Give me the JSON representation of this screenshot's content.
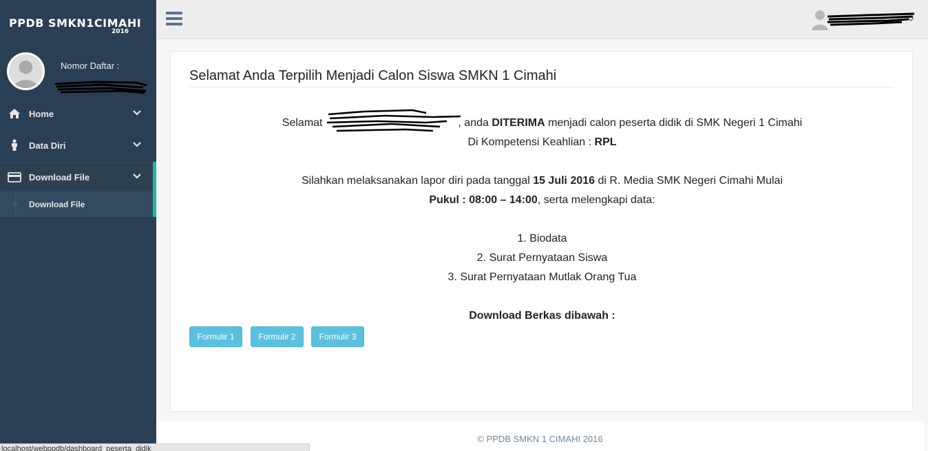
{
  "sidebar": {
    "brand": "PPDB  SMKN1CIMAHI",
    "brand_year": "2016",
    "profile_label": "Nomor Daftar :",
    "menu": [
      {
        "label": "Home",
        "icon": "home-icon"
      },
      {
        "label": "Data Diri",
        "icon": "user-icon"
      },
      {
        "label": "Download File",
        "icon": "credit-card-icon"
      }
    ],
    "submenu": [
      {
        "label": "Download File"
      }
    ]
  },
  "main": {
    "title": "Selamat Anda Terpilih Menjadi Calon Siswa SMKN 1 Cimahi",
    "line1_pre": "Selamat",
    "line1_mid": " , anda ",
    "line1_bold": "DITERIMA",
    "line1_post": " menjadi calon peserta didik di SMK Negeri 1 Cimahi",
    "line2_pre": "Di Kompetensi Keahlian : ",
    "line2_bold": "RPL",
    "line3_pre": "Silahkan melaksanakan lapor diri pada tanggal ",
    "line3_bold": "15 Juli 2016",
    "line3_post": " di R. Media SMK Negeri Cimahi Mulai",
    "line4_bold": "Pukul : 08:00 – 14:00",
    "line4_post": ", serta melengkapi data:",
    "list": [
      "1. Biodata",
      "2. Surat Pernyataan Siswa",
      "3. Surat Pernyataan Mutlak Orang Tua"
    ],
    "download_heading": "Download Berkas dibawah :",
    "buttons": [
      "Formulir 1",
      "Formulir 2",
      "Formulir 3"
    ]
  },
  "footer": "© PPDB SMKN 1 CIMAHI 2016",
  "statusbar": "localhost/webppdb/dashboard_peserta_didik",
  "colors": {
    "sidebar_bg": "#2a3f54",
    "accent": "#1abb9c",
    "button": "#5bc0de"
  }
}
